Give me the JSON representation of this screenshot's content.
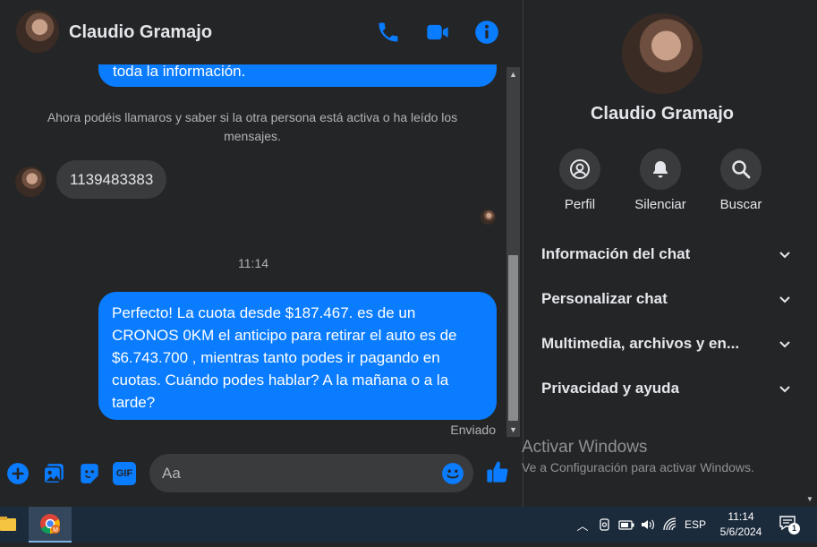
{
  "chat": {
    "contact_name": "Claudio Gramajo",
    "top_message_fragment": "toda la información.",
    "system_note": "Ahora podéis llamaros y saber si la otra persona está activa o ha leído los mensajes.",
    "incoming_message": "1139483383",
    "time_separator": "11:14",
    "outgoing_message": "Perfecto! La cuota desde $187.467. es de un CRONOS 0KM el anticipo para retirar el auto es de $6.743.700 , mientras tanto podes ir pagando en cuotas. Cuándo podes hablar? A la mañana o a la tarde?",
    "sent_status": "Enviado",
    "composer_placeholder": "Aa",
    "gif_label": "GIF"
  },
  "sidebar": {
    "name": "Claudio Gramajo",
    "actions": [
      {
        "label": "Perfil",
        "icon": "profile-icon"
      },
      {
        "label": "Silenciar",
        "icon": "bell-icon"
      },
      {
        "label": "Buscar",
        "icon": "search-icon"
      }
    ],
    "sections": [
      {
        "label": "Información del chat"
      },
      {
        "label": "Personalizar chat"
      },
      {
        "label": "Multimedia, archivos y en..."
      },
      {
        "label": "Privacidad y ayuda"
      }
    ]
  },
  "watermark": {
    "title": "Activar Windows",
    "subtitle": "Ve a Configuración para activar Windows."
  },
  "taskbar": {
    "language": "ESP",
    "time": "11:14",
    "date": "5/6/2024",
    "notification_count": "1"
  },
  "colors": {
    "accent": "#0a7cff",
    "background": "#242526",
    "bubble_incoming": "#3a3b3c",
    "taskbar": "#1c2b3c"
  }
}
